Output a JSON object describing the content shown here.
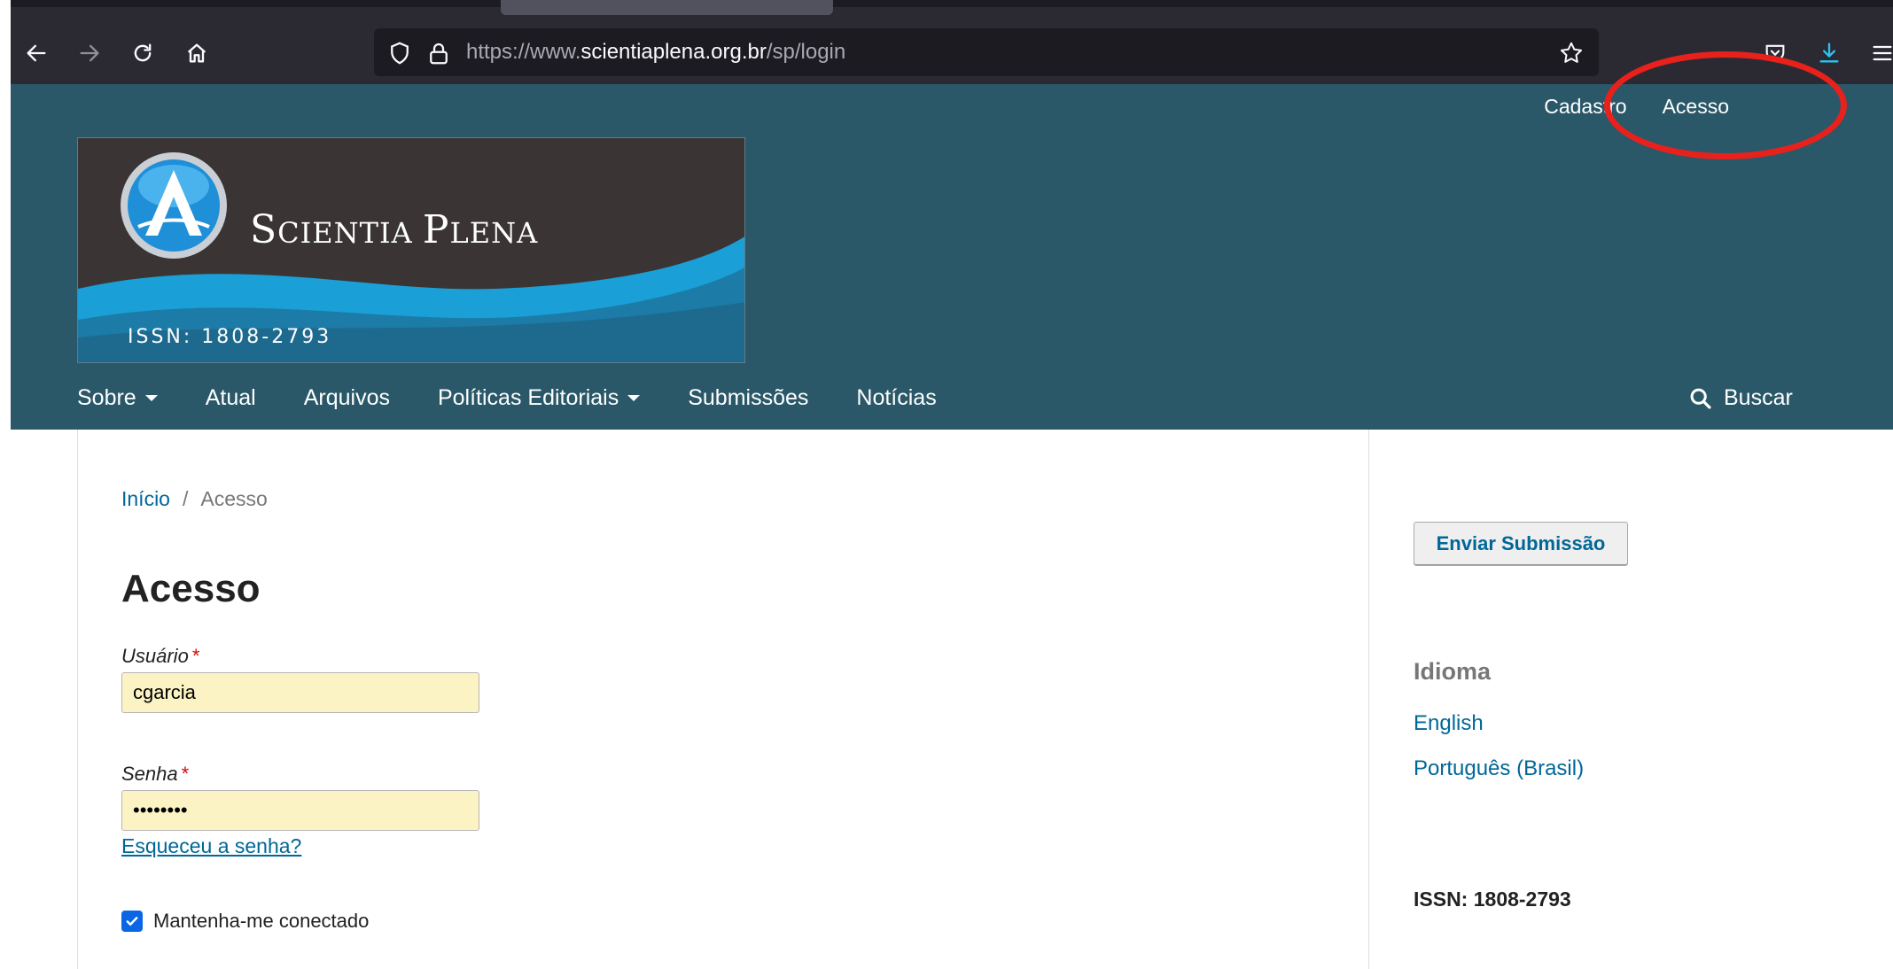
{
  "browser": {
    "url_prefix": "https://www.",
    "url_host": "scientiaplena.org.br",
    "url_path": "/sp/login"
  },
  "header": {
    "user_links": [
      "Cadastro",
      "Acesso"
    ],
    "logo": {
      "title_first": "S",
      "title_first_rest": "CIENTIA ",
      "title_second": "P",
      "title_second_rest": "LENA",
      "issn": "ISSN: 1808-2793"
    },
    "nav": [
      "Sobre",
      "Atual",
      "Arquivos",
      "Políticas Editoriais",
      "Submissões",
      "Notícias"
    ],
    "search_label": "Buscar"
  },
  "breadcrumb": {
    "home": "Início",
    "separator": "/",
    "current": "Acesso"
  },
  "page_title": "Acesso",
  "form": {
    "username_label": "Usuário",
    "username_value": "cgarcia",
    "password_label": "Senha",
    "password_value": "••••••••",
    "required_mark": "*",
    "forgot_link": "Esqueceu a senha?",
    "remember_label": "Mantenha-me conectado",
    "remember_checked": true
  },
  "sidebar": {
    "submit_button": "Enviar Submissão",
    "language_title": "Idioma",
    "languages": [
      "English",
      "Português (Brasil)"
    ],
    "issn": "ISSN: 1808-2793"
  },
  "colors": {
    "header_bg": "#2a5868",
    "link": "#006798",
    "annotation": "#e8211c",
    "field_bg": "#fcf3c4"
  }
}
